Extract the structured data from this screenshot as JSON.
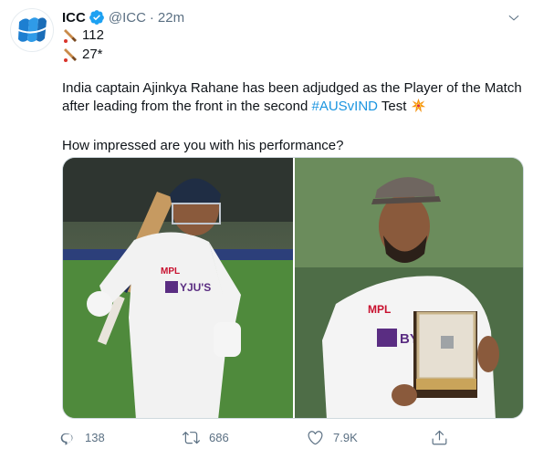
{
  "tweet": {
    "author": {
      "name": "ICC",
      "handle": "@ICC",
      "time": "22m",
      "verified": true
    },
    "stats_lines": [
      {
        "emoji": "cricket-bat-icon",
        "text": "112"
      },
      {
        "emoji": "cricket-bat-icon",
        "text": "27*"
      }
    ],
    "text": {
      "p1_before": "India captain Ajinkya Rahane has been adjudged as the Player of the Match after leading from the front in the second ",
      "hashtag": "#AUSvIND",
      "p1_after": " Test ",
      "p1_emoji": "collision-icon",
      "p2": "How impressed are you with his performance?"
    },
    "media": [
      {
        "name": "photo-batting",
        "icon": "photo"
      },
      {
        "name": "photo-award",
        "icon": "photo"
      }
    ],
    "actions": {
      "reply_count": "138",
      "retweet_count": "686",
      "like_count": "7.9K"
    },
    "colors": {
      "accent": "#1da1f2",
      "link": "#1b95e0",
      "muted": "#5b7083",
      "text": "#0f1419"
    }
  }
}
